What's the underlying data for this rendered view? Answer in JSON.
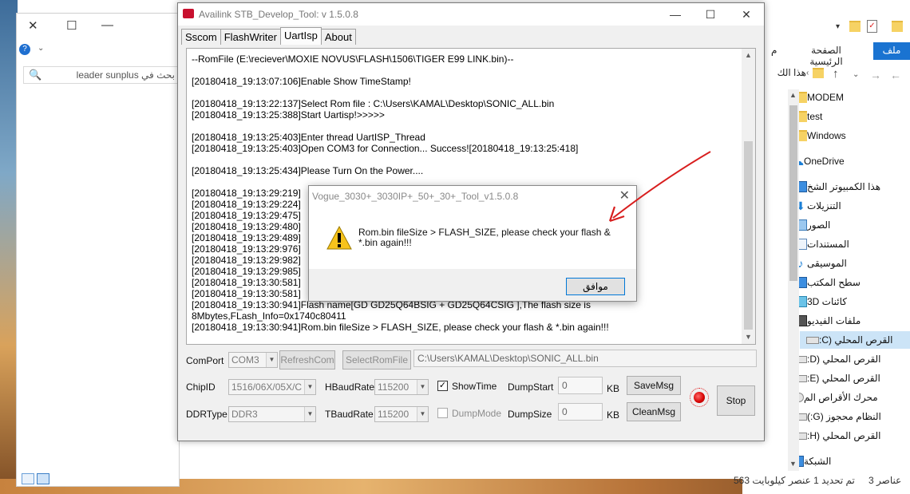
{
  "main_window": {
    "title": "Availink STB_Develop_Tool: v 1.5.0.8",
    "tabs": [
      "Sscom",
      "FlashWriter",
      "UartIsp",
      "About"
    ],
    "active_tab": "UartIsp",
    "log": [
      "--RomFile (E:\\reciever\\MOXIE NOVUS\\FLASH\\1506\\TIGER E99 LINK.bin)--",
      "",
      "[20180418_19:13:07:106]Enable Show TimeStamp!",
      "",
      "[20180418_19:13:22:137]Select Rom file : C:\\Users\\KAMAL\\Desktop\\SONIC_ALL.bin",
      "[20180418_19:13:25:388]Start Uartisp!>>>>>",
      "",
      "[20180418_19:13:25:403]Enter thread UartISP_Thread",
      "[20180418_19:13:25:403]Open COM3 for Connection... Success![20180418_19:13:25:418]",
      "",
      "[20180418_19:13:25:434]Please Turn On the Power....",
      "",
      "[20180418_19:13:29:219]                                                                                      efully!!",
      "[20180418_19:13:29:224]",
      "[20180418_19:13:29:475]                                                                                      !",
      "[20180418_19:13:29:480]",
      "[20180418_19:13:29:489]",
      "[20180418_19:13:29:976]                                                                                      3:29:979]",
      "[20180418_19:13:29:982]",
      "[20180418_19:13:29:985]",
      "[20180418_19:13:30:581]                                                                                      :30:581]",
      "[20180418_19:13:30:581]",
      "[20180418_19:13:30:941]Flash name[GD GD25Q64BSIG + GD25Q64CSIG ],The flash size is",
      "8Mbytes,FLash_Info=0x1740c80411",
      "[20180418_19:13:30:941]Rom.bin fileSize > FLASH_SIZE, please check your flash & *.bin again!!!"
    ],
    "controls": {
      "comport_label": "ComPort",
      "comport_value": "COM3",
      "refresh_label": "RefreshCom",
      "selectrom_label": "SelectRomFile",
      "rom_path": "C:\\Users\\KAMAL\\Desktop\\SONIC_ALL.bin",
      "chipid_label": "ChipID",
      "chipid_value": "1516/06X/05X/C",
      "hbaud_label": "HBaudRate",
      "hbaud_value": "115200",
      "showtime_label": "ShowTime",
      "showtime_checked": true,
      "dumpstart_label": "DumpStart",
      "dumpstart_value": "0",
      "kb1": "KB",
      "savemsg_label": "SaveMsg",
      "stop_label": "Stop",
      "ddrtype_label": "DDRType",
      "ddrtype_value": "DDR3",
      "tbaud_label": "TBaudRate",
      "tbaud_value": "115200",
      "dumpmode_label": "DumpMode",
      "dumpmode_checked": false,
      "dumpsize_label": "DumpSize",
      "dumpsize_value": "0",
      "kb2": "KB",
      "cleanmsg_label": "CleanMsg",
      "status_led_color": "#d60000"
    }
  },
  "dialog": {
    "title": "Vogue_3030+_3030IP+_50+_30+_Tool_v1.5.0.8",
    "message": "Rom.bin fileSize > FLASH_SIZE, please check your flash & *.bin again!!!",
    "ok_label": "موافق",
    "icon": "warning-icon"
  },
  "left_window": {
    "search_placeholder": "بحث في leader sunplus"
  },
  "right_window": {
    "tabs": {
      "file": "ملف",
      "home": "الصفحة الرئيسية",
      "cut": "م"
    },
    "address": "هذا الك",
    "nav_items": [
      {
        "label": "MODEM",
        "icon": "folder-icon"
      },
      {
        "label": "test",
        "icon": "folder-icon"
      },
      {
        "label": "Windows",
        "icon": "folder-icon"
      },
      {
        "label": "OneDrive",
        "icon": "cloud-icon"
      },
      {
        "label": "هذا الكمبيوتر الشخ",
        "icon": "computer-icon"
      },
      {
        "label": "التنزيلات",
        "icon": "download-icon"
      },
      {
        "label": "الصور",
        "icon": "pictures-icon"
      },
      {
        "label": "المستندات",
        "icon": "documents-icon"
      },
      {
        "label": "الموسيقى",
        "icon": "music-icon"
      },
      {
        "label": "سطح المكتب",
        "icon": "desktop-icon"
      },
      {
        "label": "كائنات 3D",
        "icon": "3d-objects-icon"
      },
      {
        "label": "ملفات الفيديو",
        "icon": "video-icon"
      },
      {
        "label": "القرص المحلي (C:",
        "icon": "drive-icon"
      },
      {
        "label": "القرص المحلي (D:",
        "icon": "drive-icon"
      },
      {
        "label": "القرص المحلي (E:",
        "icon": "drive-icon"
      },
      {
        "label": "محرك الأقراص الم",
        "icon": "cd-drive-icon"
      },
      {
        "label": "النظام محجوز (G:)",
        "icon": "drive-icon"
      },
      {
        "label": "القرص المحلي (H:",
        "icon": "drive-icon"
      },
      {
        "label": "الشبكة",
        "icon": "network-icon"
      }
    ],
    "selected_nav": "القرص المحلي (C:",
    "status": {
      "items": "3 عناصر",
      "selected": "تم تحديد 1 عنصر",
      "size": "563 كيلوبايت"
    }
  },
  "colors": {
    "accent_blue": "#1a73d1",
    "selection": "#cce4f7",
    "annotation_arrow": "#d81e1e"
  }
}
